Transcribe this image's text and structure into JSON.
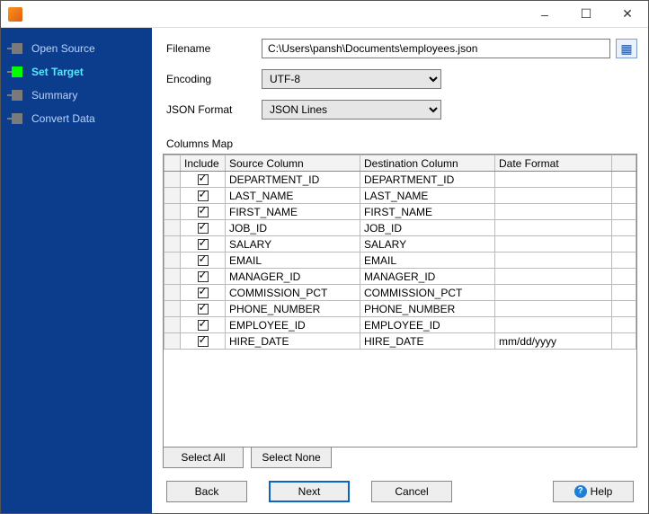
{
  "titlebar": {
    "minimize": "–",
    "maximize": "☐",
    "close": "✕"
  },
  "sidebar": {
    "steps": [
      {
        "label": "Open Source",
        "active": false
      },
      {
        "label": "Set Target",
        "active": true
      },
      {
        "label": "Summary",
        "active": false
      },
      {
        "label": "Convert Data",
        "active": false
      }
    ]
  },
  "form": {
    "filename_label": "Filename",
    "filename_value": "C:\\Users\\pansh\\Documents\\employees.json",
    "encoding_label": "Encoding",
    "encoding_value": "UTF-8",
    "json_format_label": "JSON Format",
    "json_format_value": "JSON Lines",
    "columns_map_label": "Columns Map"
  },
  "grid": {
    "headers": {
      "include": "Include",
      "source": "Source Column",
      "destination": "Destination Column",
      "date_format": "Date Format"
    },
    "rows": [
      {
        "include": true,
        "source": "DEPARTMENT_ID",
        "destination": "DEPARTMENT_ID",
        "date_format": ""
      },
      {
        "include": true,
        "source": "LAST_NAME",
        "destination": "LAST_NAME",
        "date_format": ""
      },
      {
        "include": true,
        "source": "FIRST_NAME",
        "destination": "FIRST_NAME",
        "date_format": ""
      },
      {
        "include": true,
        "source": "JOB_ID",
        "destination": "JOB_ID",
        "date_format": ""
      },
      {
        "include": true,
        "source": "SALARY",
        "destination": "SALARY",
        "date_format": ""
      },
      {
        "include": true,
        "source": "EMAIL",
        "destination": "EMAIL",
        "date_format": ""
      },
      {
        "include": true,
        "source": "MANAGER_ID",
        "destination": "MANAGER_ID",
        "date_format": ""
      },
      {
        "include": true,
        "source": "COMMISSION_PCT",
        "destination": "COMMISSION_PCT",
        "date_format": ""
      },
      {
        "include": true,
        "source": "PHONE_NUMBER",
        "destination": "PHONE_NUMBER",
        "date_format": ""
      },
      {
        "include": true,
        "source": "EMPLOYEE_ID",
        "destination": "EMPLOYEE_ID",
        "date_format": ""
      },
      {
        "include": true,
        "source": "HIRE_DATE",
        "destination": "HIRE_DATE",
        "date_format": "mm/dd/yyyy"
      }
    ]
  },
  "buttons": {
    "select_all": "Select All",
    "select_none": "Select None",
    "back": "Back",
    "next": "Next",
    "cancel": "Cancel",
    "help": "Help"
  }
}
